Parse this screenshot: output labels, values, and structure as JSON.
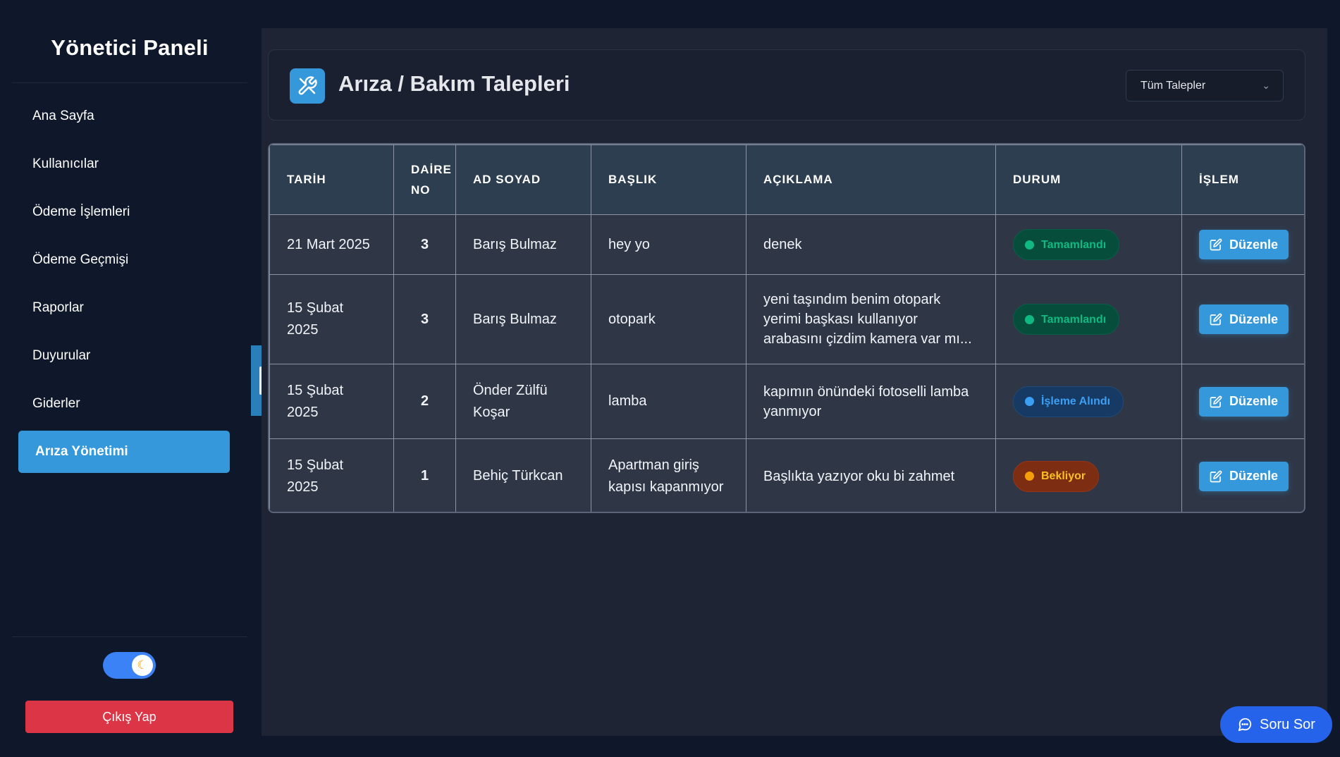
{
  "sidebar": {
    "title": "Yönetici Paneli",
    "items": [
      {
        "label": "Ana Sayfa",
        "active": false
      },
      {
        "label": "Kullanıcılar",
        "active": false
      },
      {
        "label": "Ödeme İşlemleri",
        "active": false
      },
      {
        "label": "Ödeme Geçmişi",
        "active": false
      },
      {
        "label": "Raporlar",
        "active": false
      },
      {
        "label": "Duyurular",
        "active": false
      },
      {
        "label": "Giderler",
        "active": false
      },
      {
        "label": "Arıza Yönetimi",
        "active": true
      }
    ],
    "theme_toggle": {
      "state": "dark",
      "icon": "moon-icon"
    },
    "logout_label": "Çıkış Yap"
  },
  "header": {
    "icon": "tools-icon",
    "title": "Arıza / Bakım Talepleri",
    "filter_value": "Tüm Talepler"
  },
  "table": {
    "columns": [
      "TARİH",
      "DAİRE NO",
      "AD SOYAD",
      "BAŞLIK",
      "AÇIKLAMA",
      "DURUM",
      "İŞLEM"
    ],
    "rows": [
      {
        "date": "21 Mart 2025",
        "unit": "3",
        "name": "Barış Bulmaz",
        "title": "hey yo",
        "description": "denek",
        "status": "Tamamlandı",
        "status_type": "done",
        "action": "Düzenle"
      },
      {
        "date": "15 Şubat 2025",
        "unit": "3",
        "name": "Barış Bulmaz",
        "title": "otopark",
        "description": "yeni taşındım benim otopark yerimi başkası kullanıyor arabasını çizdim kamera var mı...",
        "status": "Tamamlandı",
        "status_type": "done",
        "action": "Düzenle"
      },
      {
        "date": "15 Şubat 2025",
        "unit": "2",
        "name": "Önder Zülfü Koşar",
        "title": "lamba",
        "description": "kapımın önündeki fotoselli lamba yanmıyor",
        "status": "İşleme Alındı",
        "status_type": "progress",
        "action": "Düzenle"
      },
      {
        "date": "15 Şubat 2025",
        "unit": "1",
        "name": "Behiç Türkcan",
        "title": "Apartman giriş kapısı kapanmıyor",
        "description": "Başlıkta yazıyor oku bi zahmet",
        "status": "Bekliyor",
        "status_type": "wait",
        "action": "Düzenle"
      }
    ]
  },
  "chat_button": {
    "label": "Soru Sor",
    "icon": "chat-icon"
  },
  "colors": {
    "accent": "#3498db",
    "danger": "#dc3545",
    "chat": "#2563eb",
    "status_done": "#10b981",
    "status_progress": "#3b9ff3",
    "status_wait": "#f59e0b"
  }
}
